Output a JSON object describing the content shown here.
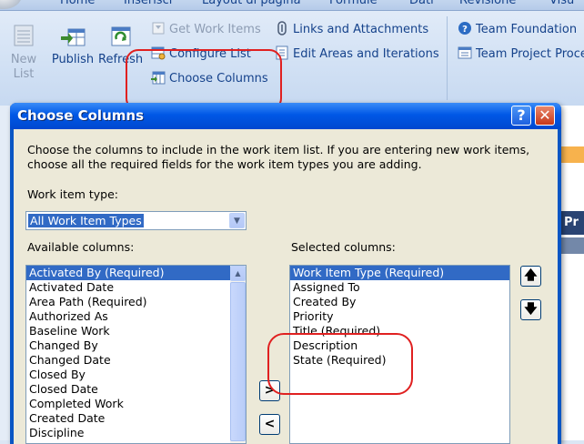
{
  "ribbon": {
    "tabs": [
      "Home",
      "Inserisci",
      "Layout di pagina",
      "Formule",
      "Dati",
      "Revisione",
      "Visu"
    ],
    "buttons": {
      "new_list": "New\nList",
      "publish": "Publish",
      "refresh": "Refresh",
      "get_work_items": "Get Work Items",
      "configure_list": "Configure List",
      "choose_columns": "Choose Columns",
      "links_and_attachments": "Links and Attachments",
      "edit_areas_and_iterations": "Edit Areas and Iterations",
      "team_foundation": "Team Foundation",
      "team_project_process": "Team Project Proce"
    }
  },
  "sheet": {
    "header_fragment": "Pr"
  },
  "dialog": {
    "title": "Choose Columns",
    "help_label": "?",
    "close_label": "✕",
    "instructions": "Choose the columns to include in the work item list.  If you are entering new work items, choose all the required fields for the work item types you are adding.",
    "work_item_type_label": "Work item type:",
    "work_item_type_value": "All Work Item Types",
    "available_label": "Available columns:",
    "selected_label": "Selected columns:",
    "available_columns": [
      "Activated By (Required)",
      "Activated Date",
      "Area Path (Required)",
      "Authorized As",
      "Baseline Work",
      "Changed By",
      "Changed Date",
      "Closed By",
      "Closed Date",
      "Completed Work",
      "Created Date",
      "Discipline"
    ],
    "selected_columns": [
      "Work Item Type (Required)",
      "Assigned To",
      "Created By",
      "Priority",
      "Title (Required)",
      "Description",
      "State (Required)"
    ],
    "add_label": ">",
    "remove_label": "<",
    "move_up_label": "🡅",
    "move_down_label": "🡇"
  },
  "icons": [
    "new-list-icon",
    "publish-icon",
    "refresh-icon",
    "get-work-items-icon",
    "configure-list-icon",
    "choose-columns-icon",
    "links-icon",
    "edit-areas-icon",
    "team-foundation-icon",
    "team-project-icon"
  ]
}
